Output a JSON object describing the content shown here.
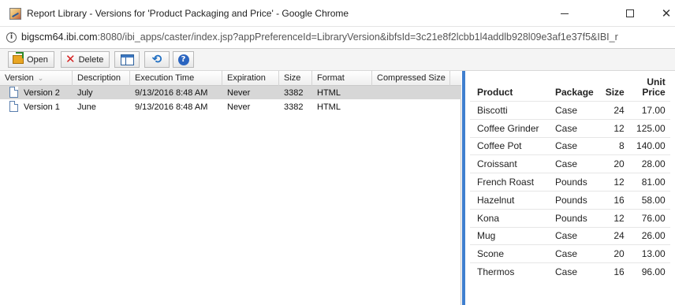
{
  "window": {
    "title": "Report Library - Versions for 'Product Packaging and Price' - Google Chrome",
    "minimize_label": "",
    "maximize_label": "",
    "close_label": "✕"
  },
  "address": {
    "host": "bigscm64.ibi.com",
    "path": ":8080/ibi_apps/caster/index.jsp?appPreferenceId=LibraryVersion&ibfsId=3c21e8f2lcbb1l4addlb928l09e3af1e37f5&IBI_r"
  },
  "toolbar": {
    "open_label": "Open",
    "delete_label": "Delete"
  },
  "versions": {
    "columns": [
      "Version",
      "Description",
      "Execution Time",
      "Expiration",
      "Size",
      "Format",
      "Compressed Size"
    ],
    "sort_indicator": "⌄",
    "rows": [
      {
        "version": "Version 2",
        "description": "July",
        "execution_time": "9/13/2016 8:48 AM",
        "expiration": "Never",
        "size": "3382",
        "format": "HTML",
        "compressed_size": "",
        "selected": true
      },
      {
        "version": "Version 1",
        "description": "June",
        "execution_time": "9/13/2016 8:48 AM",
        "expiration": "Never",
        "size": "3382",
        "format": "HTML",
        "compressed_size": "",
        "selected": false
      }
    ]
  },
  "report": {
    "headers": {
      "product": "Product",
      "package": "Package",
      "size": "Size",
      "price_line1": "Unit",
      "price_line2": "Price"
    },
    "rows": [
      {
        "product": "Biscotti",
        "package": "Case",
        "size": "24",
        "price": "17.00"
      },
      {
        "product": "Coffee Grinder",
        "package": "Case",
        "size": "12",
        "price": "125.00"
      },
      {
        "product": "Coffee Pot",
        "package": "Case",
        "size": "8",
        "price": "140.00"
      },
      {
        "product": "Croissant",
        "package": "Case",
        "size": "20",
        "price": "28.00"
      },
      {
        "product": "French Roast",
        "package": "Pounds",
        "size": "12",
        "price": "81.00"
      },
      {
        "product": "Hazelnut",
        "package": "Pounds",
        "size": "16",
        "price": "58.00"
      },
      {
        "product": "Kona",
        "package": "Pounds",
        "size": "12",
        "price": "76.00"
      },
      {
        "product": "Mug",
        "package": "Case",
        "size": "24",
        "price": "26.00"
      },
      {
        "product": "Scone",
        "package": "Case",
        "size": "20",
        "price": "13.00"
      },
      {
        "product": "Thermos",
        "package": "Case",
        "size": "16",
        "price": "96.00"
      }
    ]
  },
  "colors": {
    "selection": "#d7d7d7",
    "splitter_accent": "#3f7fcf",
    "delete_icon": "#d62020",
    "help_icon": "#2a64c0"
  },
  "icons": [
    "report-library-app-icon",
    "info-icon",
    "open-icon",
    "delete-icon",
    "view-toggle-icon",
    "refresh-icon",
    "help-icon",
    "document-icon"
  ]
}
